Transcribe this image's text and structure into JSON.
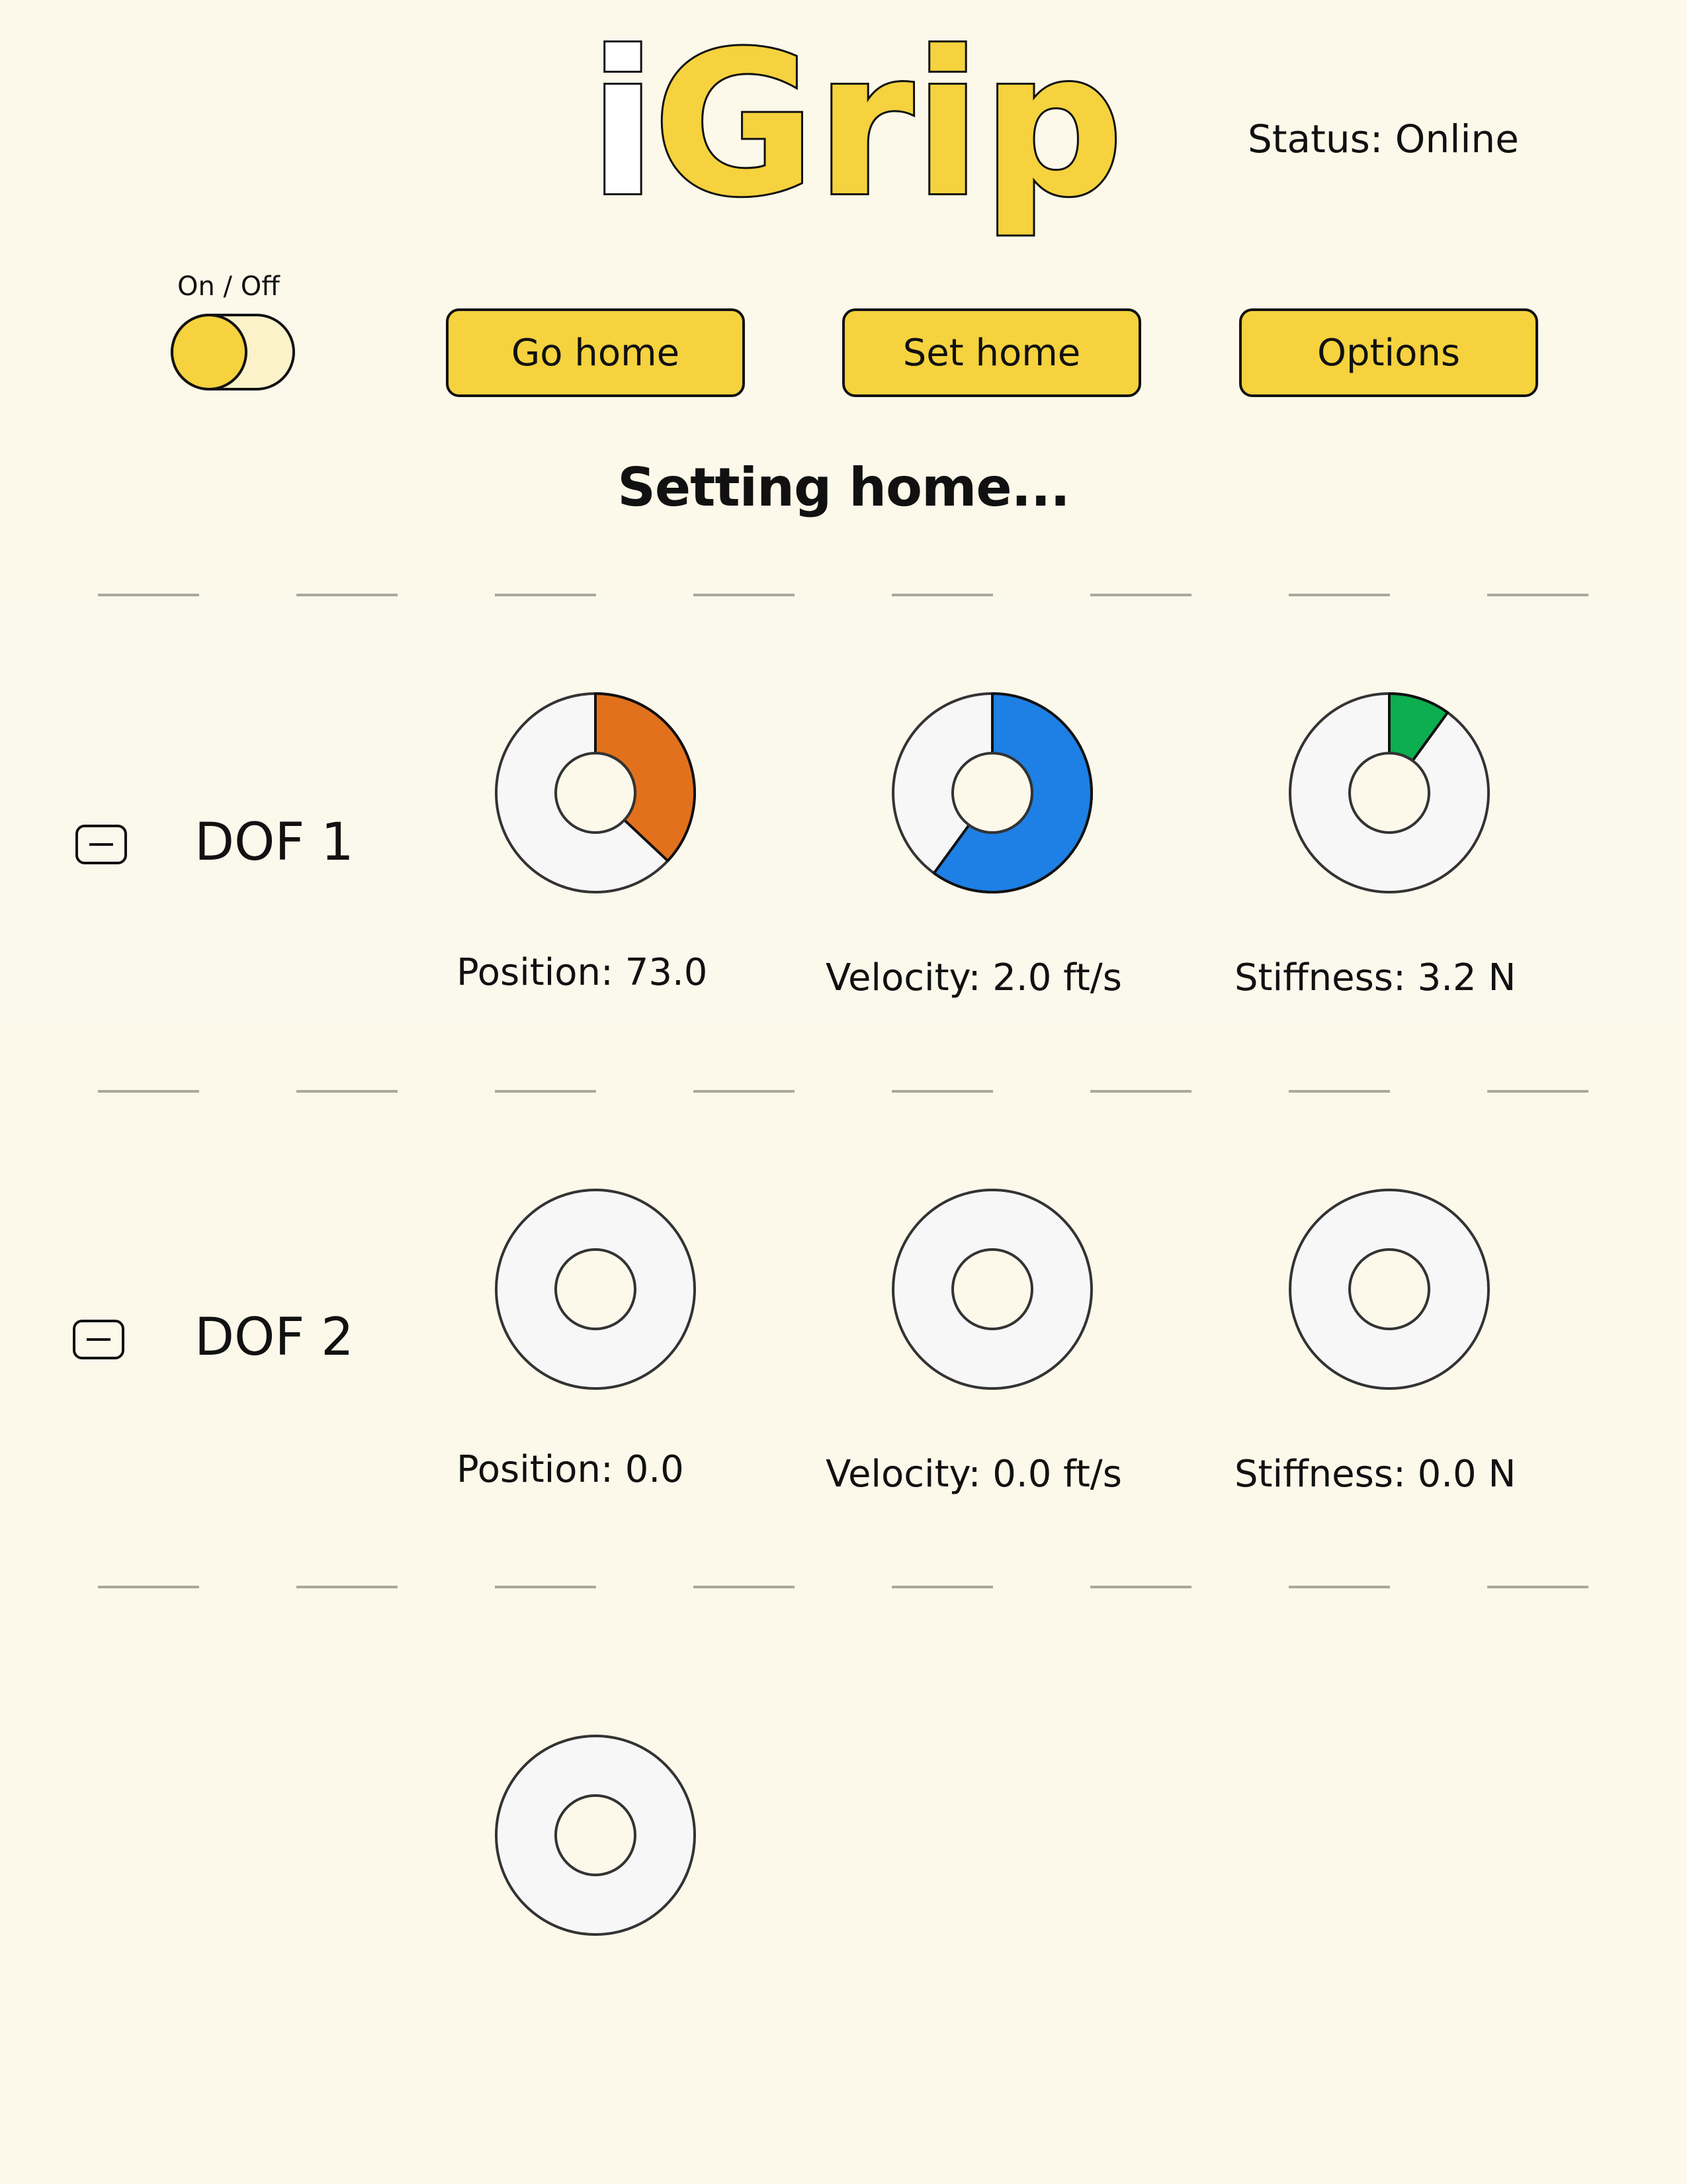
{
  "header": {
    "logo_text": "iGrip",
    "status": "Status: Online"
  },
  "controls": {
    "power_label": "On / Off",
    "power_on": true,
    "go_home_label": "Go home",
    "set_home_label": "Set home",
    "options_label": "Options"
  },
  "message": "Setting home...",
  "dofs": [
    {
      "title": "DOF 1",
      "position": {
        "label": "Position: 73.0",
        "fraction": 0.37,
        "color": "#e2711d"
      },
      "velocity": {
        "label": "Velocity: 2.0 ft/s",
        "fraction": 0.6,
        "color": "#1e7fe5"
      },
      "stiffness": {
        "label": "Stiffness: 3.2 N",
        "fraction": 0.1,
        "color": "#0cae4f"
      }
    },
    {
      "title": "DOF 2",
      "position": {
        "label": "Position: 0.0",
        "fraction": 0,
        "color": "#e2711d"
      },
      "velocity": {
        "label": "Velocity: 0.0 ft/s",
        "fraction": 0,
        "color": "#1e7fe5"
      },
      "stiffness": {
        "label": "Stiffness: 0.0 N",
        "fraction": 0,
        "color": "#0cae4f"
      }
    }
  ],
  "extra_gauge": {
    "fraction": 0
  },
  "colors": {
    "accent": "#f5d23e",
    "background": "#fdf9ea",
    "gauge_track": "#f7f7f7",
    "outline": "#111111"
  }
}
